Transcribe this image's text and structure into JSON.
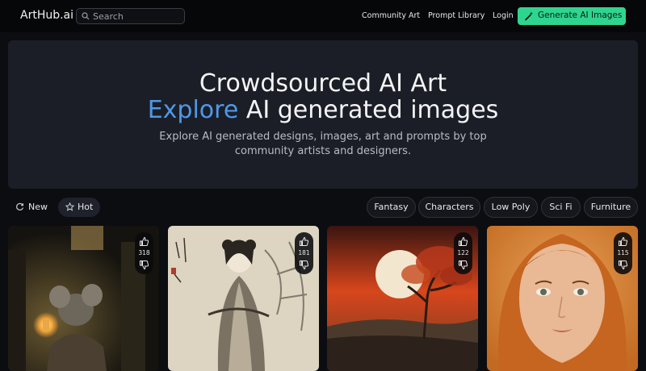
{
  "nav": {
    "logo": "ArtHub.ai",
    "search_placeholder": "Search",
    "links": [
      "Community Art",
      "Prompt Library",
      "Login"
    ],
    "generate_button": "Generate AI Images",
    "accent_color": "#2fd58f"
  },
  "hero": {
    "title_line1": "Crowdsourced AI Art",
    "title_accent": "Explore",
    "title_line2_rest": " AI generated images",
    "subtitle": "Explore AI generated designs, images, art and prompts by top community artists and designers.",
    "accent_color": "#4f98e8"
  },
  "sort": {
    "new_label": "New",
    "hot_label": "Hot",
    "active": "Hot"
  },
  "categories": [
    "Fantasy",
    "Characters",
    "Low Poly",
    "Sci Fi",
    "Furniture"
  ],
  "cards": [
    {
      "likes": "318",
      "image": "fantasy mouse with lantern"
    },
    {
      "likes": "181",
      "image": "ink painting of woman in hanfu"
    },
    {
      "likes": "122",
      "image": "tree against red sunset"
    },
    {
      "likes": "115",
      "image": "portrait of woman in orange headscarf"
    }
  ],
  "icons": {
    "search": "search-icon",
    "generate": "magic-wand-icon",
    "new": "refresh-icon",
    "hot": "star-icon",
    "upvote": "thumbs-up-icon",
    "downvote": "thumbs-down-icon"
  }
}
